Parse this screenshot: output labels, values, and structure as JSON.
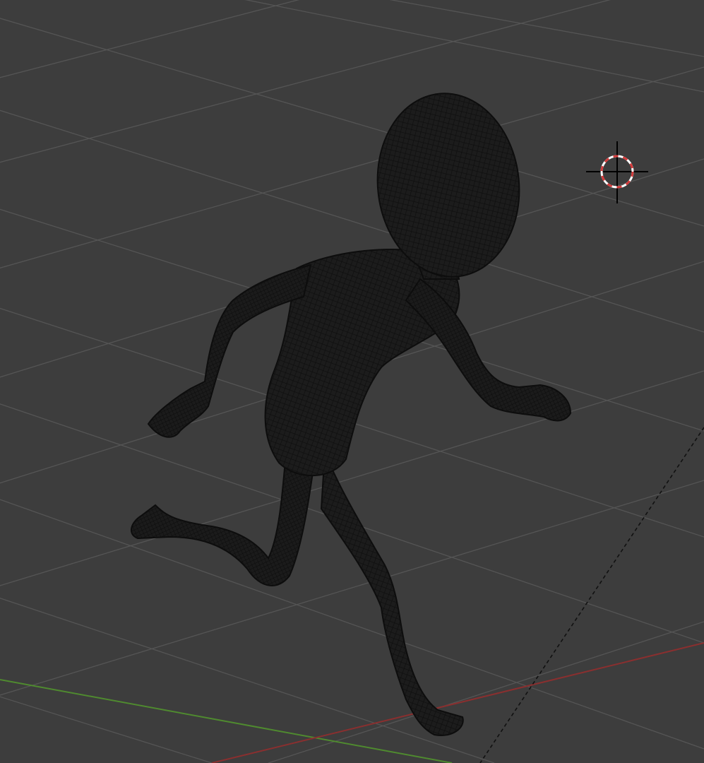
{
  "viewport": {
    "name": "3D Viewport",
    "shading_mode": "wireframe",
    "object": "running-character-mesh",
    "colors": {
      "background": "#3d3d3d",
      "grid": "#535353",
      "x_axis": "#8a2f2f",
      "y_axis": "#4f8a2f",
      "mesh_fill": "#1c1c1c",
      "mesh_wire": "#101010",
      "cursor_ring_red": "#d33a3a",
      "cursor_ring_white": "#ffffff",
      "camera_dashed": "#111111"
    },
    "icons": {
      "cursor": "3d-cursor-icon"
    }
  }
}
